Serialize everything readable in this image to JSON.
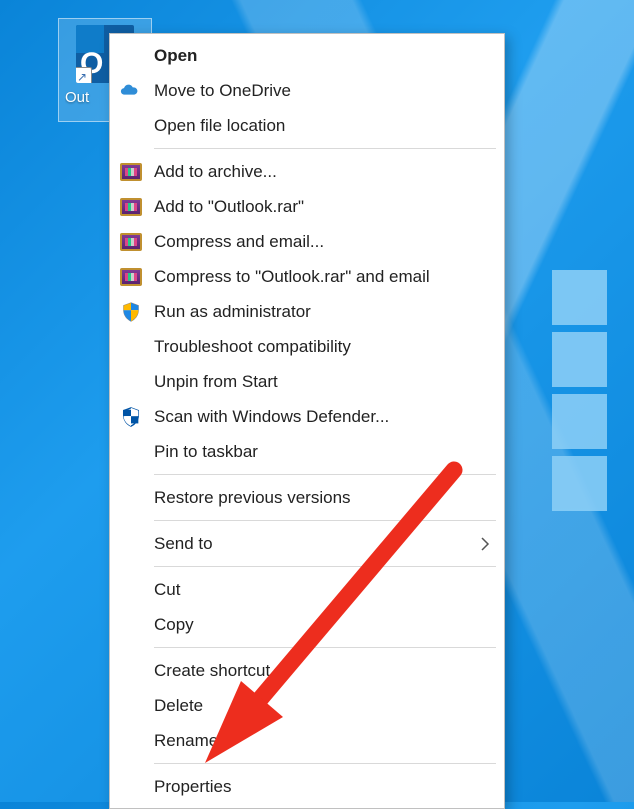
{
  "desktop": {
    "icon_label": "Out",
    "tile_letter": "O"
  },
  "menu": {
    "items": [
      {
        "key": "open",
        "label": "Open",
        "icon": null,
        "bold": true
      },
      {
        "key": "onedrive",
        "label": "Move to OneDrive",
        "icon": "onedrive"
      },
      {
        "key": "openloc",
        "label": "Open file location",
        "icon": null
      },
      {
        "key": "sep"
      },
      {
        "key": "addarchive",
        "label": "Add to archive...",
        "icon": "winrar"
      },
      {
        "key": "addoutlookrar",
        "label": "Add to \"Outlook.rar\"",
        "icon": "winrar"
      },
      {
        "key": "compressemail",
        "label": "Compress and email...",
        "icon": "winrar"
      },
      {
        "key": "compressoutlookemail",
        "label": "Compress to \"Outlook.rar\" and email",
        "icon": "winrar"
      },
      {
        "key": "runadmin",
        "label": "Run as administrator",
        "icon": "shield-uac"
      },
      {
        "key": "troubleshoot",
        "label": "Troubleshoot compatibility",
        "icon": null
      },
      {
        "key": "unpin",
        "label": "Unpin from Start",
        "icon": null
      },
      {
        "key": "defender",
        "label": "Scan with Windows Defender...",
        "icon": "shield-def"
      },
      {
        "key": "pintaskbar",
        "label": "Pin to taskbar",
        "icon": null
      },
      {
        "key": "sep"
      },
      {
        "key": "restoreprev",
        "label": "Restore previous versions",
        "icon": null
      },
      {
        "key": "sep"
      },
      {
        "key": "sendto",
        "label": "Send to",
        "icon": null,
        "submenu": true
      },
      {
        "key": "sep"
      },
      {
        "key": "cut",
        "label": "Cut",
        "icon": null
      },
      {
        "key": "copy",
        "label": "Copy",
        "icon": null
      },
      {
        "key": "sep"
      },
      {
        "key": "shortcut",
        "label": "Create shortcut",
        "icon": null
      },
      {
        "key": "delete",
        "label": "Delete",
        "icon": null
      },
      {
        "key": "rename",
        "label": "Rename",
        "icon": null
      },
      {
        "key": "sep"
      },
      {
        "key": "properties",
        "label": "Properties",
        "icon": null
      }
    ]
  }
}
